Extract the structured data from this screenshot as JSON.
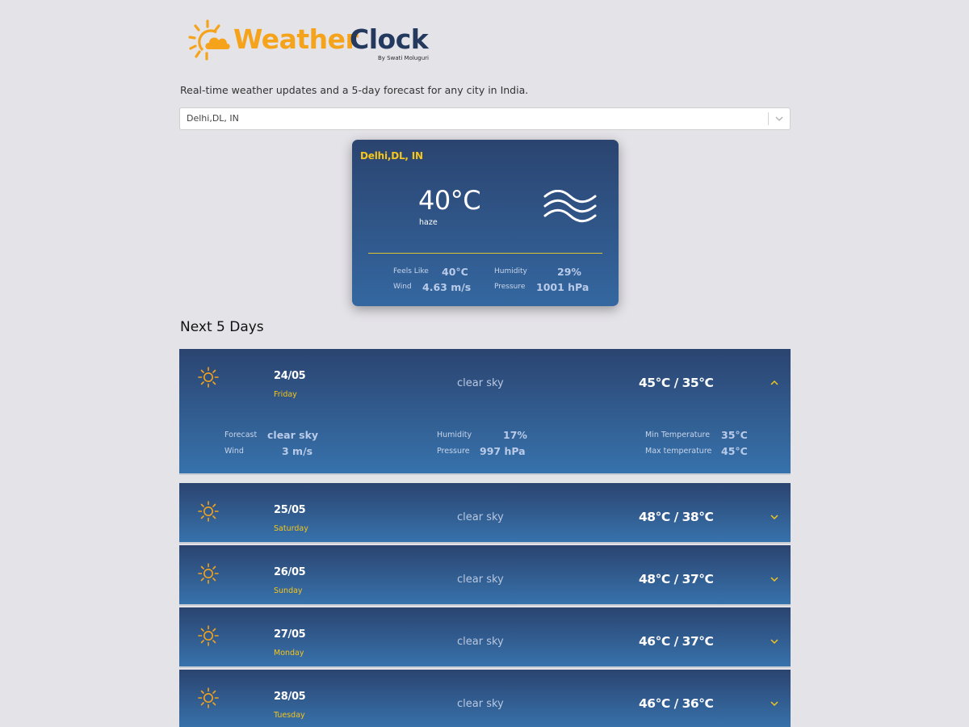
{
  "brand": {
    "word1": "Weather",
    "word2": "Clock",
    "byline": "By Swati Moluguri",
    "colors": {
      "orange": "#f5a31a",
      "navy": "#23395e"
    }
  },
  "subtitle": "Real-time weather updates and a 5-day forecast for any city in India.",
  "city_select": {
    "value": "Delhi,DL, IN",
    "icon": "chevron-down-icon"
  },
  "current": {
    "city": "Delhi,DL, IN",
    "temperature": "40°C",
    "description": "haze",
    "icon": "haze-icon",
    "details": {
      "feels_like_label": "Feels Like",
      "feels_like_value": "40°C",
      "humidity_label": "Humidity",
      "humidity_value": "29%",
      "wind_label": "Wind",
      "wind_value": "4.63 m/s",
      "pressure_label": "Pressure",
      "pressure_value": "1001 hPa"
    }
  },
  "forecast": {
    "title": "Next 5 Days",
    "detail_labels": {
      "forecast": "Forecast",
      "wind": "Wind",
      "humidity": "Humidity",
      "pressure": "Pressure",
      "min_temp": "Min Temperature",
      "max_temp": "Max temperature"
    },
    "days": [
      {
        "date": "24/05",
        "day": "Friday",
        "description": "clear sky",
        "temps": "45°C / 35°C",
        "expanded": true,
        "icon": "sun-icon",
        "details": {
          "forecast": "clear sky",
          "wind": "3 m/s",
          "humidity": "17%",
          "pressure": "997 hPa",
          "min_temp": "35°C",
          "max_temp": "45°C"
        }
      },
      {
        "date": "25/05",
        "day": "Saturday",
        "description": "clear sky",
        "temps": "48°C / 38°C",
        "expanded": false,
        "icon": "sun-icon"
      },
      {
        "date": "26/05",
        "day": "Sunday",
        "description": "clear sky",
        "temps": "48°C / 37°C",
        "expanded": false,
        "icon": "sun-icon"
      },
      {
        "date": "27/05",
        "day": "Monday",
        "description": "clear sky",
        "temps": "46°C / 37°C",
        "expanded": false,
        "icon": "sun-icon"
      },
      {
        "date": "28/05",
        "day": "Tuesday",
        "description": "clear sky",
        "temps": "46°C / 36°C",
        "expanded": false,
        "icon": "sun-icon"
      }
    ]
  }
}
